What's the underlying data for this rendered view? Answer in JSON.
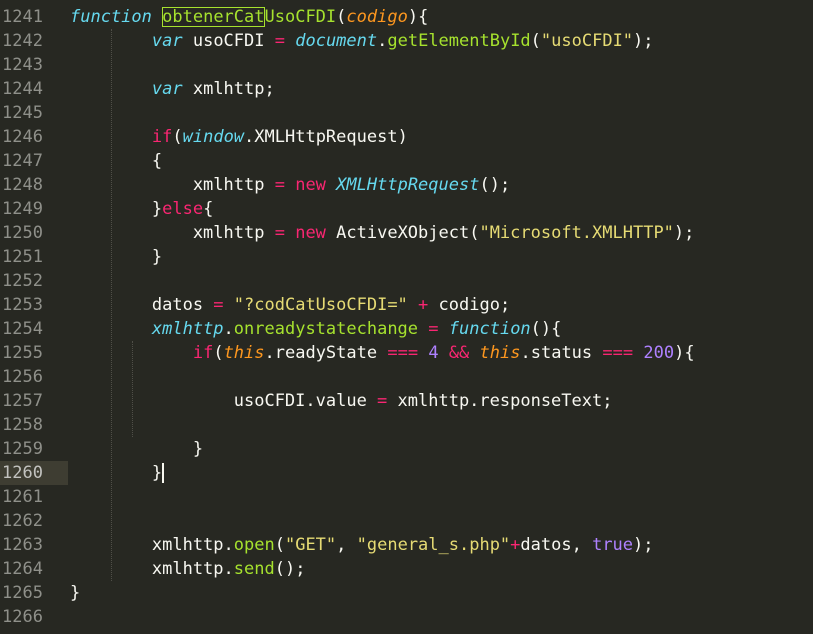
{
  "editor": {
    "active_line": "1260",
    "lines": [
      {
        "n": "1241",
        "tokens": [
          {
            "t": "function",
            "c": "kw-i"
          },
          {
            "t": " "
          },
          {
            "t": "obtenerCat",
            "c": "fn hl"
          },
          {
            "t": "UsoCFDI",
            "c": "fn"
          },
          {
            "t": "("
          },
          {
            "t": "codigo",
            "c": "prm"
          },
          {
            "t": "){"
          }
        ]
      },
      {
        "n": "1242",
        "tokens": [
          {
            "t": "        "
          },
          {
            "t": "var",
            "c": "kw-i"
          },
          {
            "t": " usoCFDI "
          },
          {
            "t": "=",
            "c": "kw"
          },
          {
            "t": " "
          },
          {
            "t": "document",
            "c": "kw-i"
          },
          {
            "t": "."
          },
          {
            "t": "getElementById",
            "c": "fn"
          },
          {
            "t": "("
          },
          {
            "t": "\"usoCFDI\"",
            "c": "str"
          },
          {
            "t": ");"
          }
        ]
      },
      {
        "n": "1243",
        "tokens": []
      },
      {
        "n": "1244",
        "tokens": [
          {
            "t": "        "
          },
          {
            "t": "var",
            "c": "kw-i"
          },
          {
            "t": " xmlhttp;"
          }
        ]
      },
      {
        "n": "1245",
        "tokens": []
      },
      {
        "n": "1246",
        "tokens": [
          {
            "t": "        "
          },
          {
            "t": "if",
            "c": "kw"
          },
          {
            "t": "("
          },
          {
            "t": "window",
            "c": "kw-i"
          },
          {
            "t": ".XMLHttpRequest)"
          }
        ]
      },
      {
        "n": "1247",
        "tokens": [
          {
            "t": "        {"
          }
        ]
      },
      {
        "n": "1248",
        "tokens": [
          {
            "t": "            xmlhttp "
          },
          {
            "t": "=",
            "c": "kw"
          },
          {
            "t": " "
          },
          {
            "t": "new",
            "c": "kw"
          },
          {
            "t": " "
          },
          {
            "t": "XMLHttpRequest",
            "c": "kw-i"
          },
          {
            "t": "();"
          }
        ]
      },
      {
        "n": "1249",
        "tokens": [
          {
            "t": "        }"
          },
          {
            "t": "else",
            "c": "kw"
          },
          {
            "t": "{"
          }
        ]
      },
      {
        "n": "1250",
        "tokens": [
          {
            "t": "            xmlhttp "
          },
          {
            "t": "=",
            "c": "kw"
          },
          {
            "t": " "
          },
          {
            "t": "new",
            "c": "kw"
          },
          {
            "t": " ActiveXObject("
          },
          {
            "t": "\"Microsoft.XMLHTTP\"",
            "c": "str"
          },
          {
            "t": ");"
          }
        ]
      },
      {
        "n": "1251",
        "tokens": [
          {
            "t": "        }"
          }
        ]
      },
      {
        "n": "1252",
        "tokens": []
      },
      {
        "n": "1253",
        "tokens": [
          {
            "t": "        datos "
          },
          {
            "t": "=",
            "c": "kw"
          },
          {
            "t": " "
          },
          {
            "t": "\"?codCatUsoCFDI=\"",
            "c": "str"
          },
          {
            "t": " "
          },
          {
            "t": "+",
            "c": "kw"
          },
          {
            "t": " codigo;"
          }
        ]
      },
      {
        "n": "1254",
        "tokens": [
          {
            "t": "        "
          },
          {
            "t": "xmlhttp",
            "c": "kw-i"
          },
          {
            "t": "."
          },
          {
            "t": "onreadystatechange",
            "c": "fn"
          },
          {
            "t": " "
          },
          {
            "t": "=",
            "c": "kw"
          },
          {
            "t": " "
          },
          {
            "t": "function",
            "c": "kw-i"
          },
          {
            "t": "(){"
          }
        ]
      },
      {
        "n": "1255",
        "tokens": [
          {
            "t": "            "
          },
          {
            "t": "if",
            "c": "kw"
          },
          {
            "t": "("
          },
          {
            "t": "this",
            "c": "prm"
          },
          {
            "t": ".readyState "
          },
          {
            "t": "===",
            "c": "kw"
          },
          {
            "t": " "
          },
          {
            "t": "4",
            "c": "num"
          },
          {
            "t": " "
          },
          {
            "t": "&&",
            "c": "kw"
          },
          {
            "t": " "
          },
          {
            "t": "this",
            "c": "prm"
          },
          {
            "t": ".status "
          },
          {
            "t": "===",
            "c": "kw"
          },
          {
            "t": " "
          },
          {
            "t": "200",
            "c": "num"
          },
          {
            "t": "){"
          }
        ]
      },
      {
        "n": "1256",
        "tokens": []
      },
      {
        "n": "1257",
        "tokens": [
          {
            "t": "                usoCFDI.value "
          },
          {
            "t": "=",
            "c": "kw"
          },
          {
            "t": " xmlhttp.responseText;"
          }
        ]
      },
      {
        "n": "1258",
        "tokens": []
      },
      {
        "n": "1259",
        "tokens": [
          {
            "t": "            }"
          }
        ]
      },
      {
        "n": "1260",
        "tokens": [
          {
            "t": "        }"
          },
          {
            "t": "",
            "c": "cursor"
          }
        ]
      },
      {
        "n": "1261",
        "tokens": []
      },
      {
        "n": "1262",
        "tokens": []
      },
      {
        "n": "1263",
        "tokens": [
          {
            "t": "        xmlhttp."
          },
          {
            "t": "open",
            "c": "fn"
          },
          {
            "t": "("
          },
          {
            "t": "\"GET\"",
            "c": "str"
          },
          {
            "t": ", "
          },
          {
            "t": "\"general_s.php\"",
            "c": "str"
          },
          {
            "t": "+",
            "c": "kw"
          },
          {
            "t": "datos, "
          },
          {
            "t": "true",
            "c": "num"
          },
          {
            "t": ");"
          }
        ]
      },
      {
        "n": "1264",
        "tokens": [
          {
            "t": "        xmlhttp."
          },
          {
            "t": "send",
            "c": "fn"
          },
          {
            "t": "();"
          }
        ]
      },
      {
        "n": "1265",
        "tokens": [
          {
            "t": "}"
          }
        ]
      },
      {
        "n": "1266",
        "tokens": []
      }
    ]
  },
  "colors": {
    "background": "#272822",
    "keyword": "#f92672",
    "storage": "#66d9ef",
    "function": "#a6e22e",
    "string": "#e6db74",
    "number": "#ae81ff",
    "parameter": "#fd971f"
  }
}
